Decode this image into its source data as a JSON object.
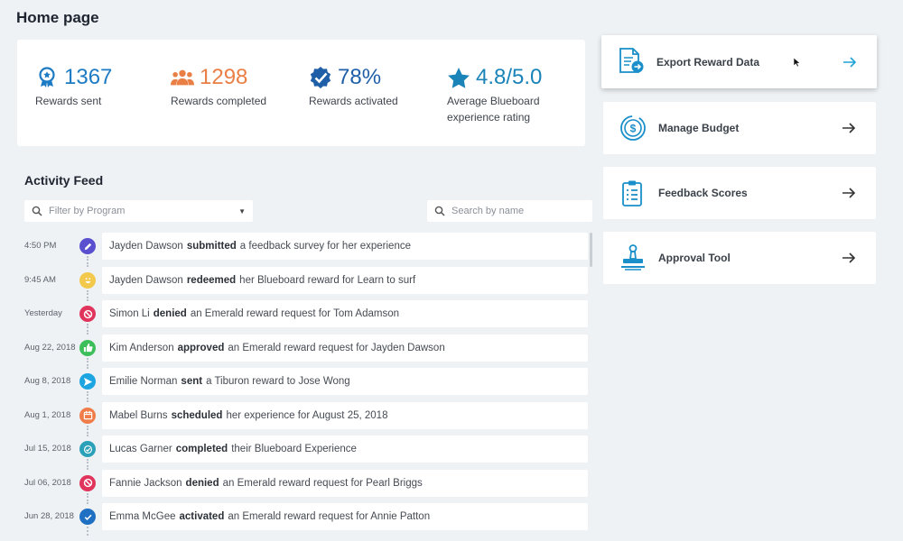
{
  "page": {
    "title": "Home page"
  },
  "stats": [
    {
      "value": "1367",
      "label": "Rewards sent",
      "icon": "ribbon-icon",
      "color": "#1d7bc4"
    },
    {
      "value": "1298",
      "label": "Rewards completed",
      "icon": "people-icon",
      "color": "#e97f45"
    },
    {
      "value": "78%",
      "label": "Rewards activated",
      "icon": "badge-check-icon",
      "color": "#1f5fa8"
    },
    {
      "value": "4.8/5.0",
      "label_line1": "Average Blueboard",
      "label_line2": "experience rating",
      "icon": "star-icon",
      "color": "#1a83b8"
    }
  ],
  "feed": {
    "title": "Activity Feed",
    "filter_placeholder": "Filter by Program",
    "search_placeholder": "Search by name",
    "items": [
      {
        "time": "4:50 PM",
        "actor": "Jayden Dawson",
        "verb": "submitted",
        "rest": "a feedback survey for her experience",
        "icon": "pencil-icon",
        "color": "#5a4fcf"
      },
      {
        "time": "9:45 AM",
        "actor": "Jayden Dawson",
        "verb": "redeemed",
        "rest": "her Blueboard reward for Learn to surf",
        "icon": "smile-icon",
        "color": "#f2c94c"
      },
      {
        "time": "Yesterday",
        "actor": "Simon Li",
        "verb": "denied",
        "rest": "an Emerald reward request for Tom Adamson",
        "icon": "ban-icon",
        "color": "#e0345c"
      },
      {
        "time": "Aug 22, 2018",
        "actor": "Kim Anderson",
        "verb": "approved",
        "rest": "an Emerald reward request for Jayden Dawson",
        "icon": "thumbs-up-icon",
        "color": "#3cbf5a"
      },
      {
        "time": "Aug 8, 2018",
        "actor": "Emilie Norman",
        "verb": "sent",
        "rest": "a Tiburon reward to Jose Wong",
        "icon": "send-icon",
        "color": "#1ca5e0"
      },
      {
        "time": "Aug 1, 2018",
        "actor": "Mabel Burns",
        "verb": "scheduled",
        "rest": "her experience for August 25, 2018",
        "icon": "calendar-icon",
        "color": "#f07c4a"
      },
      {
        "time": "Jul 15, 2018",
        "actor": "Lucas Garner",
        "verb": "completed",
        "rest": "their Blueboard Experience",
        "icon": "check-badge-icon",
        "color": "#2aa1b8"
      },
      {
        "time": "Jul 06, 2018",
        "actor": "Fannie Jackson",
        "verb": "denied",
        "rest": "an Emerald reward request for Pearl Briggs",
        "icon": "ban-icon",
        "color": "#e0345c"
      },
      {
        "time": "Jun 28, 2018",
        "actor": "Emma McGee",
        "verb": "activated",
        "rest": "an Emerald reward request for Annie Patton",
        "icon": "check-icon",
        "color": "#1f6fc2"
      }
    ]
  },
  "actions": [
    {
      "label": "Export Reward Data",
      "icon": "export-document-icon"
    },
    {
      "label": "Manage Budget",
      "icon": "budget-dollar-icon"
    },
    {
      "label": "Feedback Scores",
      "icon": "clipboard-icon"
    },
    {
      "label": "Approval Tool",
      "icon": "stamp-icon"
    }
  ]
}
